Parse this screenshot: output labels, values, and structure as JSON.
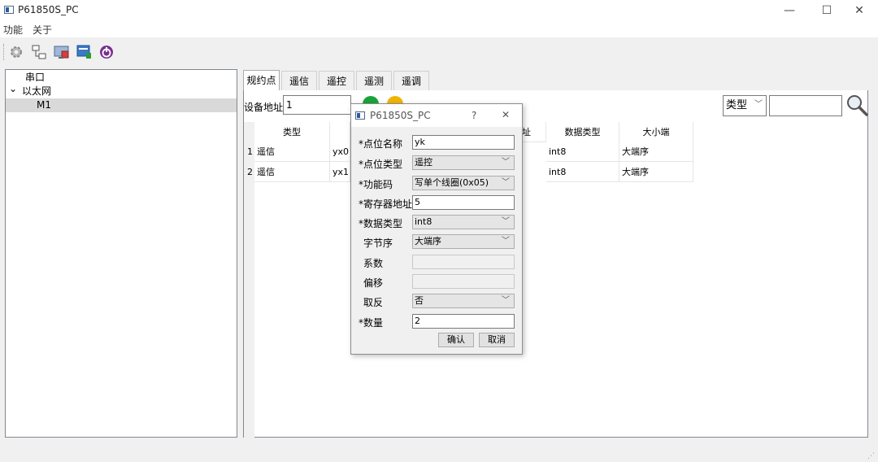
{
  "window": {
    "title": "P61850S_PC",
    "min_label": "—",
    "max_label": "☐",
    "close_label": "✕"
  },
  "menu": {
    "items": [
      "功能",
      "关于"
    ]
  },
  "toolbar": {
    "icons": [
      "gear-icon",
      "network-icon",
      "monitor-icon",
      "download-icon",
      "power-icon"
    ]
  },
  "tree": {
    "root1": "串口",
    "root2": "以太网",
    "child": "M1",
    "expander": "⌄"
  },
  "tabs": [
    "规约点",
    "遥信",
    "遥控",
    "遥测",
    "遥调"
  ],
  "device": {
    "label": "设备地址",
    "value": "1"
  },
  "filter": {
    "type_label": "类型",
    "search_value": ""
  },
  "table": {
    "headers": [
      "类型",
      "",
      "址",
      "数据类型",
      "大小端"
    ],
    "rows": [
      {
        "num": "1",
        "type": "遥信",
        "name": "yx0",
        "dtype": "int8",
        "endian": "大端序"
      },
      {
        "num": "2",
        "type": "遥信",
        "name": "yx1",
        "dtype": "int8",
        "endian": "大端序"
      }
    ]
  },
  "dialog": {
    "title": "P61850S_PC",
    "help": "?",
    "close": "✕",
    "fields": {
      "name_label": "*点位名称",
      "name_value": "yk",
      "ptype_label": "*点位类型",
      "ptype_value": "遥控",
      "func_label": "*功能码",
      "func_value": "写单个线圈(0x05)",
      "reg_label": "*寄存器地址",
      "reg_value": "5",
      "dtype_label": "*数据类型",
      "dtype_value": "int8",
      "order_label": "字节序",
      "order_value": "大端序",
      "coef_label": "系数",
      "coef_value": "",
      "offset_label": "偏移",
      "offset_value": "",
      "invert_label": "取反",
      "invert_value": "否",
      "count_label": "*数量",
      "count_value": "2"
    },
    "confirm": "确认",
    "cancel": "取消"
  },
  "colors": {
    "add": "#1aa33a",
    "remove": "#f0b400",
    "power": "#7a2f8f"
  }
}
